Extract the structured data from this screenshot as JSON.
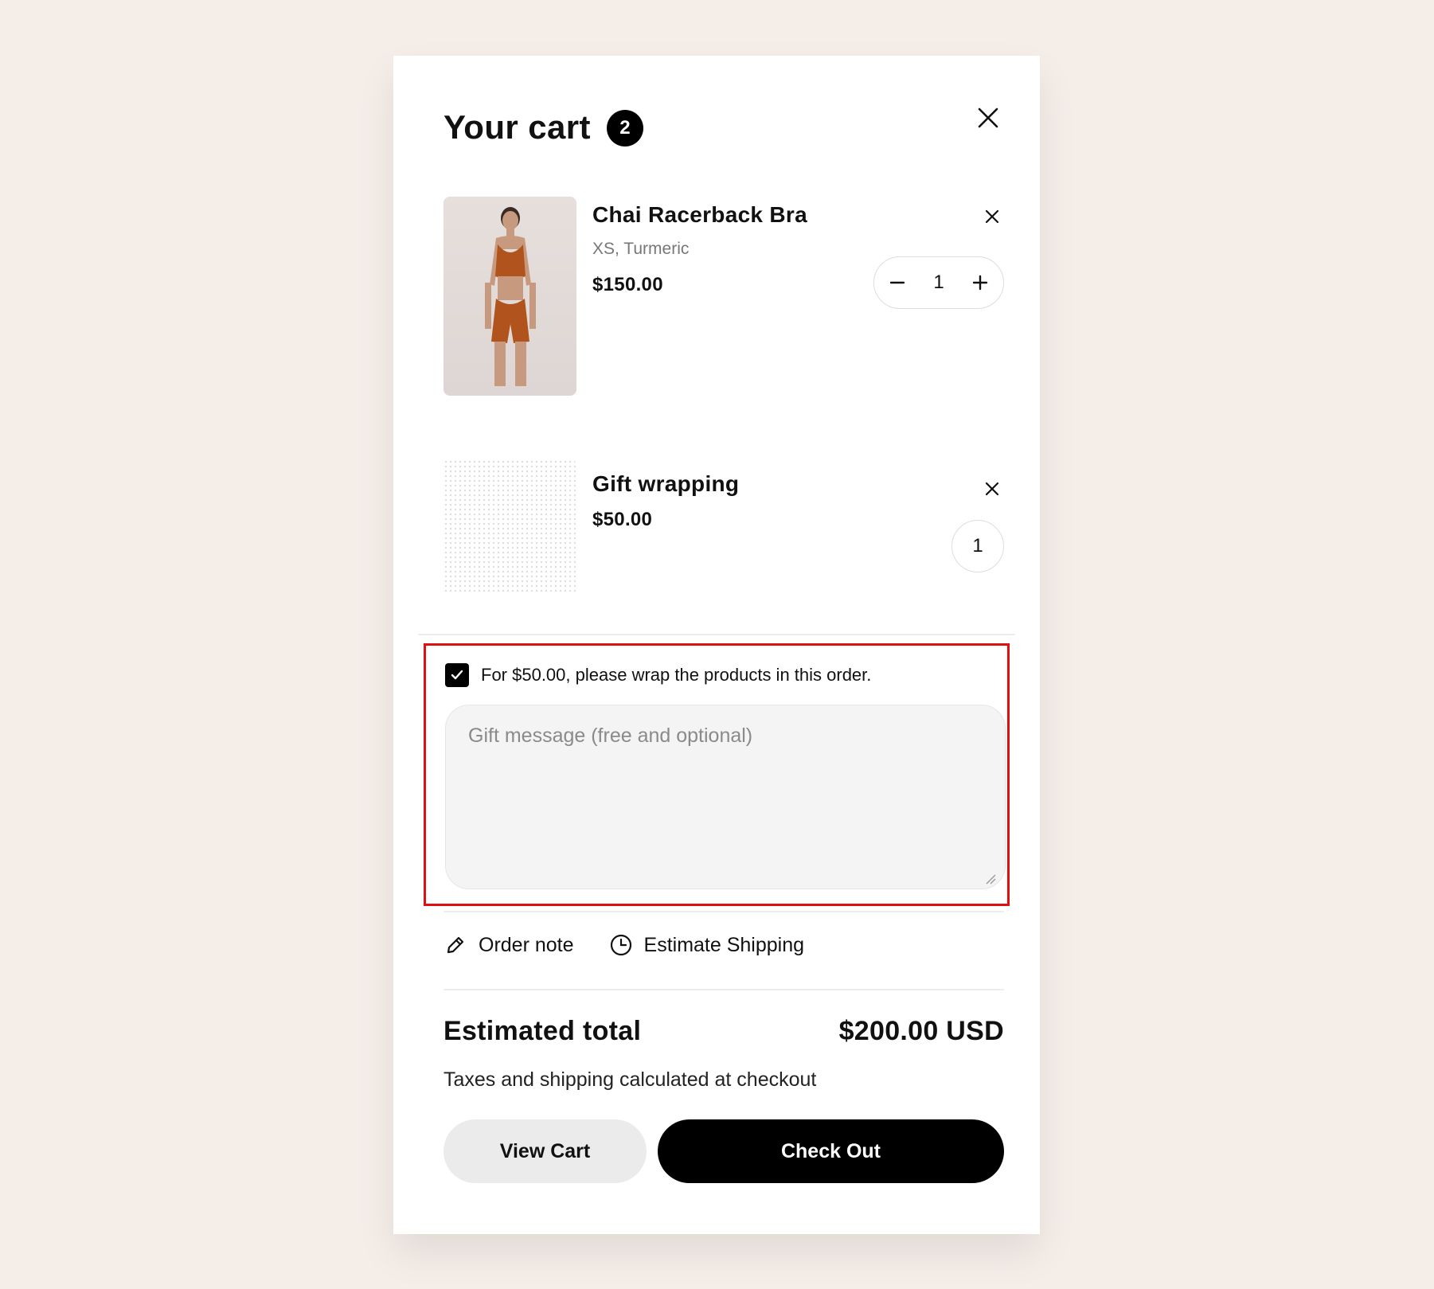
{
  "cart": {
    "title": "Your cart",
    "count": "2"
  },
  "items": [
    {
      "name": "Chai Racerback Bra",
      "variant": "XS, Turmeric",
      "price": "$150.00",
      "quantity": "1",
      "image_icon": "product-photo"
    },
    {
      "name": "Gift wrapping",
      "price": "$50.00",
      "quantity": "1",
      "image_icon": "dotted-pattern"
    }
  ],
  "gift": {
    "checkbox_label": "For $50.00, please wrap the products in this order.",
    "checked": true,
    "message_placeholder": "Gift message (free and optional)",
    "highlight_color": "#e01010"
  },
  "links": {
    "order_note": "Order note",
    "estimate_shipping": "Estimate Shipping"
  },
  "summary": {
    "total_label": "Estimated total",
    "total_value": "$200.00 USD",
    "tax_note": "Taxes and shipping calculated at checkout"
  },
  "buttons": {
    "view_cart": "View Cart",
    "check_out": "Check Out"
  },
  "colors": {
    "page_background": "#f4ede8",
    "primary_button": "#000000",
    "secondary_button": "#ebebeb",
    "product_color": "#b0531c"
  }
}
